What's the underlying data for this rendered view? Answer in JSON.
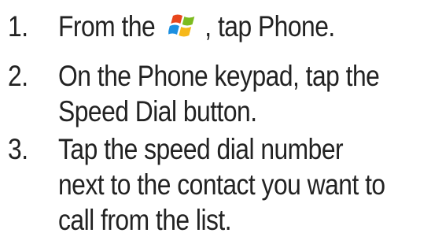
{
  "steps": [
    {
      "number": "1.",
      "text_before_icon": "From the",
      "icon": "windows-start-icon",
      "text_after_icon": ", tap Phone."
    },
    {
      "number": "2.",
      "lines": [
        "On the Phone keypad, tap the",
        "Speed Dial button."
      ]
    },
    {
      "number": "3.",
      "lines": [
        "Tap the speed dial number",
        "next to the contact you want to",
        "call from the list."
      ]
    }
  ],
  "colors": {
    "text": "#222222",
    "flag_red": "#e8461c",
    "flag_green": "#7cbb1f",
    "flag_blue": "#1c8fe0",
    "flag_yellow": "#f6b81a"
  }
}
